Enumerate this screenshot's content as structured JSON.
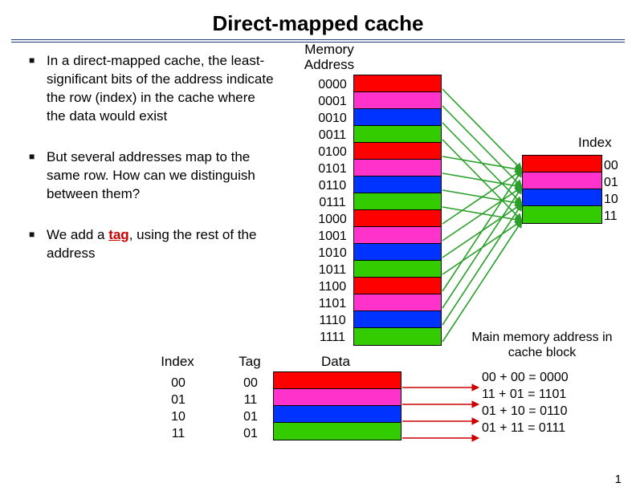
{
  "title": "Direct-mapped cache",
  "bullets": {
    "b1_pre": "In a direct-mapped cache, the ",
    "b1_em": "least-significant bits",
    "b1_post": " of the address indicate the row (index) in the cache where the data would exist",
    "b2": "But several addresses map to the same row. How can we distinguish between them?",
    "b3_pre": "We add a ",
    "b3_tag": "tag",
    "b3_post": ", using the rest of the address"
  },
  "memory": {
    "header": "Memory\nAddress",
    "addresses": [
      "0000",
      "0001",
      "0010",
      "0011",
      "0100",
      "0101",
      "0110",
      "0111",
      "1000",
      "1001",
      "1010",
      "1011",
      "1100",
      "1101",
      "1110",
      "1111"
    ]
  },
  "cache": {
    "index_label": "Index",
    "indices": [
      "00",
      "01",
      "10",
      "11"
    ]
  },
  "bottom": {
    "index_label": "Index",
    "tag_label": "Tag",
    "data_label": "Data",
    "index": [
      "00",
      "01",
      "10",
      "11"
    ],
    "tag": [
      "00",
      "11",
      "01",
      "01"
    ]
  },
  "mainmem": {
    "title": "Main memory address in cache block",
    "rows": [
      "00 + 00 = 0000",
      "11 + 01 = 1101",
      "01 + 10 = 0110",
      "01 + 11 = 0111"
    ]
  },
  "chart_data": {
    "type": "table",
    "title": "Direct-mapped cache address mapping",
    "memory_rows": [
      {
        "address": "0000",
        "color": "red"
      },
      {
        "address": "0001",
        "color": "pink"
      },
      {
        "address": "0010",
        "color": "blue"
      },
      {
        "address": "0011",
        "color": "green"
      },
      {
        "address": "0100",
        "color": "red"
      },
      {
        "address": "0101",
        "color": "pink"
      },
      {
        "address": "0110",
        "color": "blue"
      },
      {
        "address": "0111",
        "color": "green"
      },
      {
        "address": "1000",
        "color": "red"
      },
      {
        "address": "1001",
        "color": "pink"
      },
      {
        "address": "1010",
        "color": "blue"
      },
      {
        "address": "1011",
        "color": "green"
      },
      {
        "address": "1100",
        "color": "red"
      },
      {
        "address": "1101",
        "color": "pink"
      },
      {
        "address": "1110",
        "color": "blue"
      },
      {
        "address": "1111",
        "color": "green"
      }
    ],
    "cache_rows": [
      {
        "index": "00",
        "color": "red"
      },
      {
        "index": "01",
        "color": "pink"
      },
      {
        "index": "10",
        "color": "blue"
      },
      {
        "index": "11",
        "color": "green"
      }
    ],
    "cache_contents": [
      {
        "index": "00",
        "tag": "00",
        "block_address": "0000",
        "color": "red"
      },
      {
        "index": "01",
        "tag": "11",
        "block_address": "1101",
        "color": "pink"
      },
      {
        "index": "10",
        "tag": "01",
        "block_address": "0110",
        "color": "blue"
      },
      {
        "index": "11",
        "tag": "01",
        "block_address": "0111",
        "color": "green"
      }
    ]
  },
  "page": "1"
}
